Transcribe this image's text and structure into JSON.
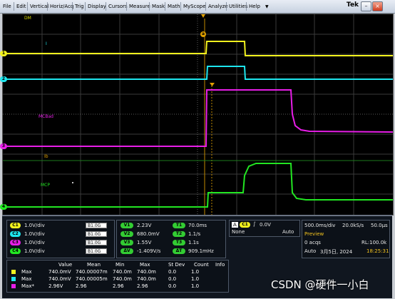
{
  "menu": {
    "items": [
      "File",
      "Edit",
      "Vertical",
      "Horiz/Acq",
      "Trig",
      "Display",
      "Cursors",
      "Measure",
      "Mask",
      "Math",
      "MyScope",
      "Analyze",
      "Utilities",
      "Help"
    ],
    "help_arrow": "▼",
    "brand": "Tek"
  },
  "screen": {
    "trace_labels": {
      "dm": "DM",
      "i": "I",
      "mcbad": "MCBad",
      "ib": "Ib",
      "mcp": "MCP"
    },
    "ch_markers": [
      "1",
      "2",
      "3",
      "4"
    ],
    "cursor_marker_a": "a",
    "cursor_marker_b": "b",
    "colors": {
      "ch1": "#f2f21e",
      "ch2": "#1ee6ee",
      "ch3": "#e81ee8",
      "ch4": "#22e622",
      "grid": "#3c3c3c",
      "cursor": "#e0a000"
    }
  },
  "channels": [
    {
      "id": "C1",
      "scale": "1.0V/div",
      "bw": "1.0G",
      "color": "#f2f21e"
    },
    {
      "id": "C2",
      "scale": "1.0V/div",
      "bw": "1.0G",
      "color": "#1ee6ee"
    },
    {
      "id": "C3",
      "scale": "1.0V/div",
      "bw": "1.0G",
      "color": "#e81ee8"
    },
    {
      "id": "C4",
      "scale": "1.0V/div",
      "bw": "1.0G",
      "color": "#22e622"
    }
  ],
  "bw_prefix": "B",
  "cursors": [
    {
      "id": "V1",
      "value": "2.23V"
    },
    {
      "id": "V2",
      "value": "680.0mV"
    },
    {
      "id": "V3",
      "value": "1.55V"
    },
    {
      "id": "ΔV",
      "value": "-1.409V/s"
    }
  ],
  "time_cursors": [
    {
      "id": "T1",
      "value": "70.0ms"
    },
    {
      "id": "T2",
      "value": "1.1/s"
    },
    {
      "id": "T3",
      "value": "1.1s"
    },
    {
      "id": "ΔT",
      "value": "909.1mHz"
    }
  ],
  "trigger": {
    "mode_a": "A",
    "channel": "C1",
    "slope": "∫",
    "level": "0.0V",
    "type": "None",
    "run": "Auto"
  },
  "horizontal": {
    "scale": "500.0ms/div",
    "rate": "20.0kS/s",
    "res": "50.0µs",
    "preview": "Preview",
    "acqs": "0 acqs",
    "rl": "RL:100.0k",
    "mode": "Auto",
    "date": "3月5日, 2024",
    "time": "18:25:31"
  },
  "measure": {
    "headers": [
      "Value",
      "Mean",
      "Min",
      "Max",
      "St Dev",
      "Count",
      "Info"
    ],
    "rows": [
      {
        "label": "Max",
        "color": "#f2f21e",
        "cells": [
          "740.0mV",
          "740.00007m",
          "740.0m",
          "740.0m",
          "0.0",
          "1.0",
          ""
        ]
      },
      {
        "label": "Max",
        "color": "#1ee6ee",
        "cells": [
          "740.0mV",
          "740.00005m",
          "740.0m",
          "740.0m",
          "0.0",
          "1.0",
          ""
        ]
      },
      {
        "label": "Max*",
        "color": "#e81ee8",
        "cells": [
          "2.96V",
          "2.96",
          "2.96",
          "2.96",
          "0.0",
          "1.0",
          ""
        ]
      }
    ]
  },
  "watermark": "CSDN @硬件一小白"
}
